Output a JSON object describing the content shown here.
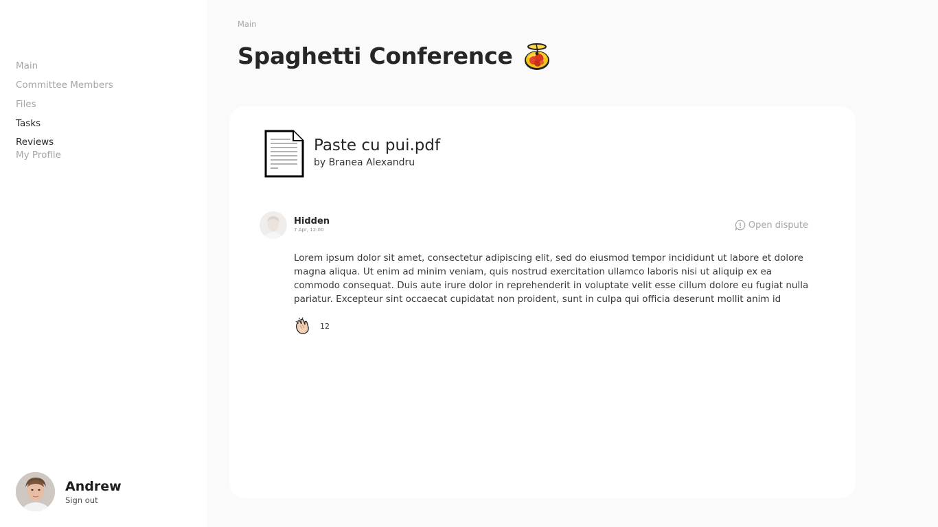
{
  "sidebar": {
    "items": [
      {
        "label": "Main"
      },
      {
        "label": "Committee Members"
      },
      {
        "label": "Files"
      },
      {
        "label": "Tasks"
      },
      {
        "label": "Reviews"
      },
      {
        "label": "My Profile"
      }
    ],
    "active_item": "Tasks",
    "user": {
      "name": "Andrew",
      "sign_out_label": "Sign out",
      "avatar_icon": "person-avatar"
    }
  },
  "header": {
    "breadcrumb": "Main",
    "title": "Spaghetti Conference",
    "title_icon": "spaghetti-emoji"
  },
  "file": {
    "icon": "document-icon",
    "name": "Paste cu pui.pdf",
    "author": "by Branea Alexandru"
  },
  "review": {
    "reviewer": "Hidden",
    "date": "7 Apr, 12:00",
    "dispute_label": "Open dispute",
    "dispute_icon": "alert-bubble-icon",
    "body": "Lorem ipsum dolor sit amet, consectetur adipiscing elit, sed do eiusmod tempor incididunt ut labore et dolore magna aliqua. Ut enim ad minim veniam, quis nostrud exercitation ullamco laboris nisi ut aliquip ex ea commodo consequat. Duis aute irure dolor in reprehenderit in voluptate velit esse cillum dolore eu fugiat nulla pariatur. Excepteur sint occaecat cupidatat non proident, sunt in culpa qui officia deserunt mollit anim id",
    "clap_icon": "clapping-hands-icon",
    "clap_count": "12"
  },
  "colors": {
    "background": "#fafafa",
    "surface": "#ffffff",
    "text": "#262626",
    "muted": "#a6a6a6"
  }
}
